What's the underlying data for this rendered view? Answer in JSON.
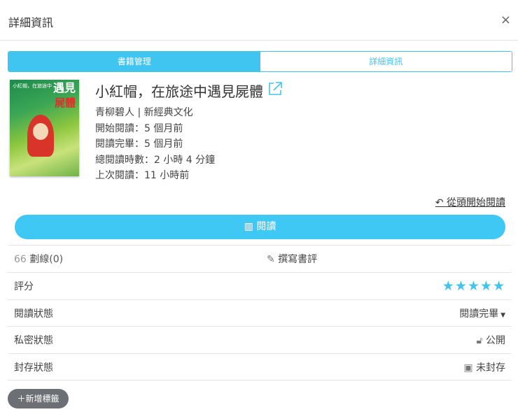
{
  "header": {
    "title": "詳細資訊",
    "close": "×"
  },
  "tabs": [
    {
      "label": "書籍管理"
    },
    {
      "label": "詳細資訊"
    }
  ],
  "book": {
    "cover_text": {
      "series": "小紅帽，在旅途中",
      "title_a": "遇見",
      "title_b": "屍體"
    },
    "title": "小紅帽，在旅途中遇見屍體",
    "author_publisher": "青柳碧人 | 新經典文化",
    "start_reading": "開始閱讀：5 個月前",
    "finished_reading": "閱讀完畢：5 個月前",
    "total_time": "總閱讀時數：2 小時 4 分鐘",
    "last_read": "上次閱讀：11 小時前"
  },
  "restart_label": "從頭開始閱讀",
  "read_label": "閱讀",
  "highlights_label": "劃線(0)",
  "review_label": "撰寫書評",
  "rating": {
    "label": "評分",
    "value": 5,
    "max": 5
  },
  "reading_status": {
    "label": "閱讀狀態",
    "value": "閱讀完畢"
  },
  "privacy": {
    "label": "私密狀態",
    "value": "公開"
  },
  "archive": {
    "label": "封存狀態",
    "value": "未封存"
  },
  "add_tag_label": "新增標籤",
  "colors": {
    "accent": "#40c4f0"
  }
}
